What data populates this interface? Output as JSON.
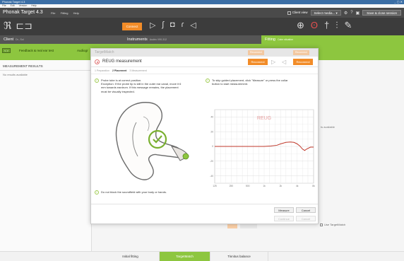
{
  "os": {
    "title": "Phonak Target 4.3",
    "menus": [
      "File",
      "Edit",
      "Version",
      "Help"
    ]
  },
  "app": {
    "brand": "Phonak Target 4.3",
    "menus": [
      "File",
      "Fitting",
      "Help"
    ],
    "client_view_label": "Client view",
    "select_media_label": "Select media...",
    "save_close_label": "Save & close session"
  },
  "toolbar": {
    "connect_label": "Connect"
  },
  "sections": {
    "client": {
      "title": "Client",
      "subtitle": "Dr., Sol"
    },
    "instruments": {
      "title": "Instruments",
      "subtitle": "Audéo V90-312"
    },
    "fitting": {
      "title": "Fitting",
      "subtitle": "Calm situation"
    }
  },
  "strip": {
    "nav_arrows": "< >",
    "tabs": [
      "Feedback & real ear test",
      "Audiogr"
    ]
  },
  "left_panel": {
    "header": "MEASUREMENT RESULTS",
    "message": "No results available"
  },
  "background": {
    "no_data_text": "ts available",
    "use_targetmatch": "Use TargetMatch"
  },
  "bottom_tabs": [
    {
      "label": "Initial fitting",
      "active": false
    },
    {
      "label": "TargetMatch",
      "active": true
    },
    {
      "label": "Tinnitus balance",
      "active": false
    }
  ],
  "modal": {
    "window_title": "TargetMatch",
    "ghost_buttons": [
      "Reconnect",
      "Reconnect"
    ],
    "title": "REUG measurement",
    "reconnect_label": "Reconnect",
    "reconnect_right_label": "Reconnect",
    "steps": [
      {
        "label": "1 Preparation",
        "current": false
      },
      {
        "label": "2 Placement",
        "current": true
      },
      {
        "label": "3 Measurement",
        "current": false
      }
    ],
    "placement_text_1": "Probe tube is at correct position.",
    "placement_text_2": "Exception: If the probe tip is still in the outer ear canal, move it 6",
    "placement_text_3": "mm towards eardrum. If this message remains, the placement",
    "placement_text_4": "must be visually inspected.",
    "skip_text_1": "To skip guided placement, click \"Measure\" or press the collar",
    "skip_text_2": "button to start measurement.",
    "soundfield_text": "Do not block the soundfield with your body or hands.",
    "measure_label": "Measure",
    "cancel_label": "Cancel",
    "continue_label": "Continue",
    "cancel2_label": "Cancel"
  },
  "colors": {
    "accent_green": "#8dc63f",
    "accent_orange": "#f28c28",
    "curve_red": "#c0392b"
  },
  "chart_data": {
    "type": "line",
    "title": "REUG",
    "xlabel": "",
    "ylabel": "",
    "x_ticks": [
      "125",
      "250",
      "500",
      "1k",
      "2k",
      "4k",
      "8k"
    ],
    "y_ticks": [
      "40",
      "20",
      "0",
      "-20",
      "-40"
    ],
    "ylim": [
      -50,
      50
    ],
    "grid": true,
    "series": [
      {
        "x": [
          125,
          200,
          300,
          500,
          700,
          1000,
          1300,
          1700,
          2000,
          2500,
          3000,
          3500,
          4000,
          4500,
          5000,
          5500,
          6000,
          7000,
          8000
        ],
        "values": [
          0,
          0,
          0,
          0,
          0,
          0,
          0.5,
          1.5,
          3.5,
          5.5,
          6,
          5.5,
          3.5,
          0.5,
          -3.5,
          -5.5,
          -3.5,
          -1,
          -1
        ]
      }
    ]
  }
}
